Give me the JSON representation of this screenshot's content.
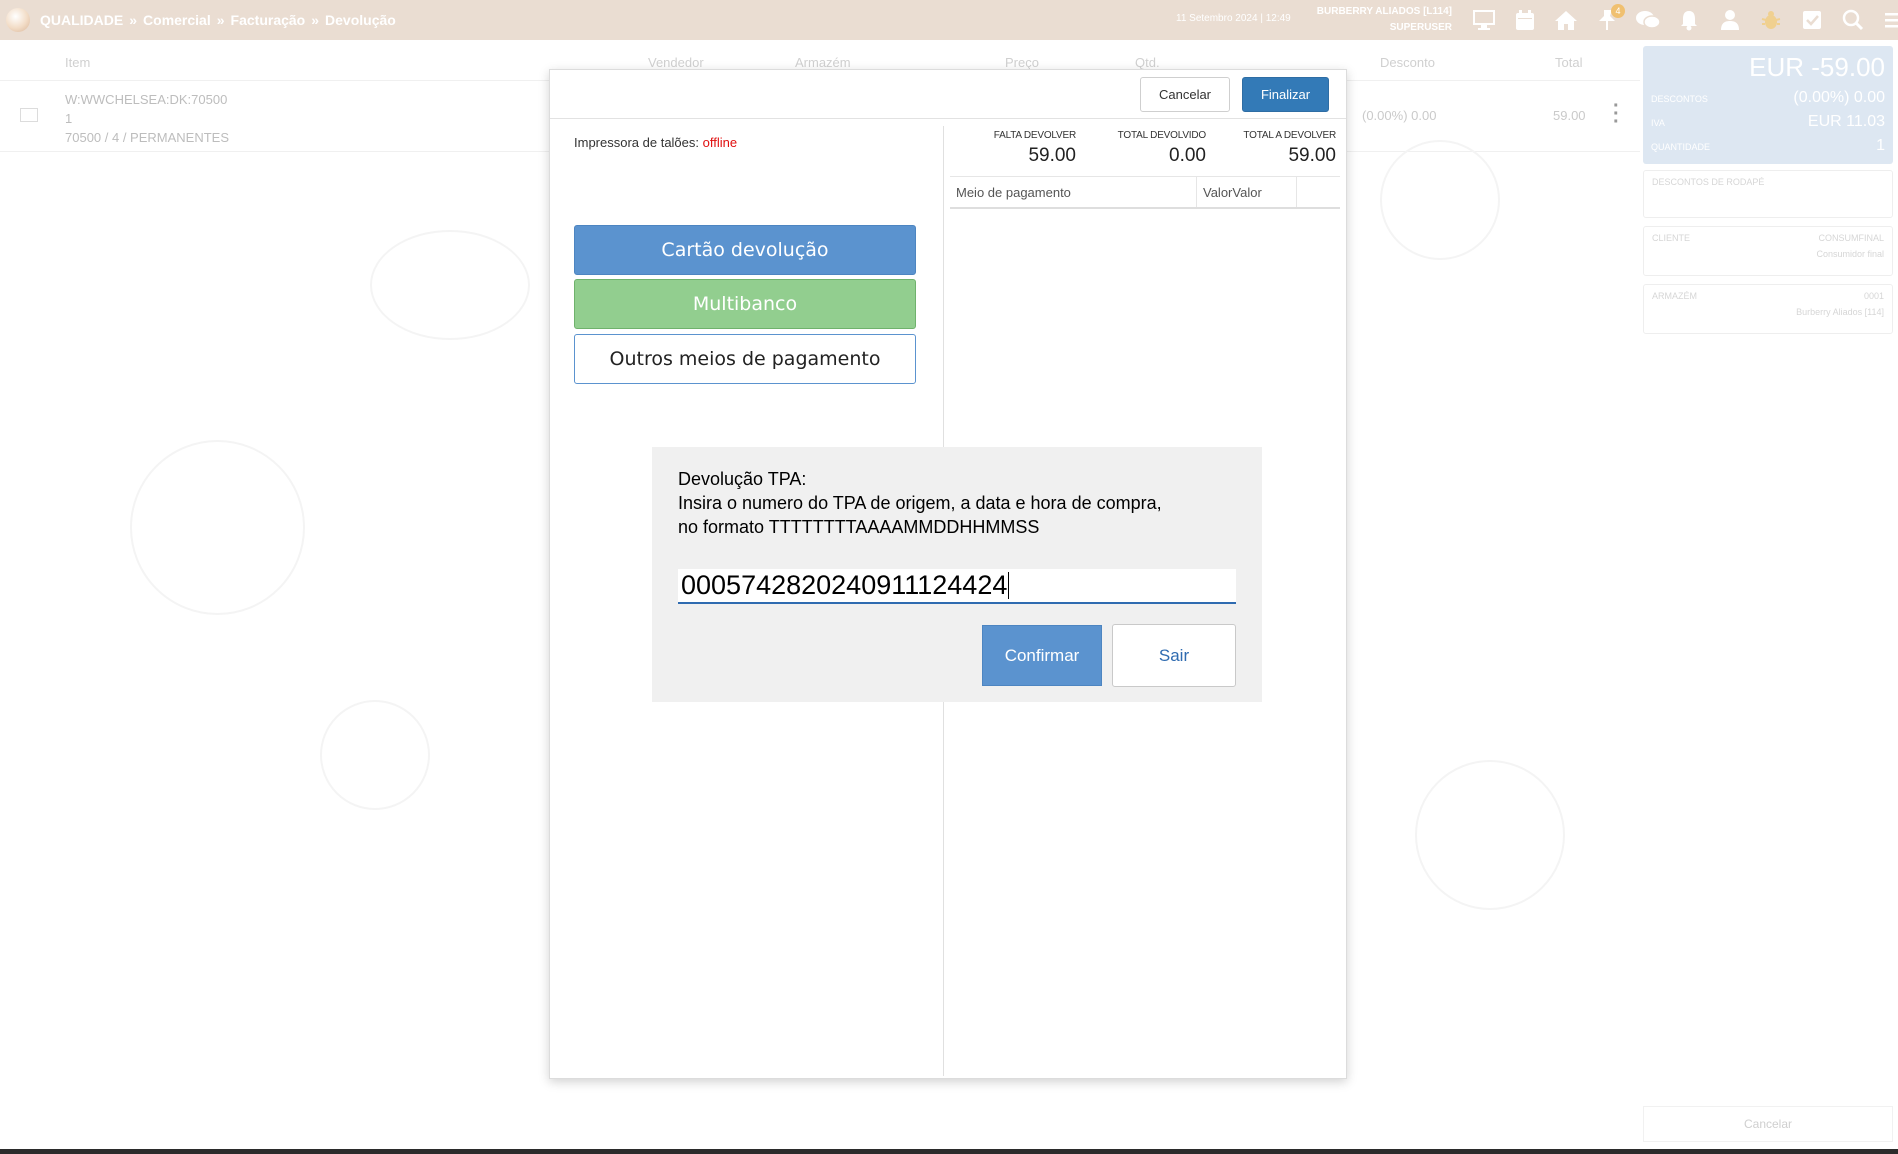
{
  "topbar": {
    "crumbs": [
      "QUALIDADE",
      "Comercial",
      "Facturação",
      "Devolução"
    ],
    "separator": "»",
    "datetime": "11 Setembro 2024 | 12:49",
    "company": "BURBERRY ALIADOS [L114]",
    "user": "SUPERUSER",
    "icons": [
      "monitor-icon",
      "calendar-icon",
      "home-icon",
      "pin-icon",
      "chat-icon",
      "bell-icon",
      "user-icon",
      "bug-icon",
      "checkbox-icon",
      "search-icon",
      "menu-icon"
    ],
    "pin_badge": "4"
  },
  "background_table": {
    "headers": {
      "item": "Item",
      "vendedor": "Vendedor",
      "armazem": "Armazém",
      "preco": "Preço",
      "qtd": "Qtd.",
      "desconto": "Desconto",
      "total": "Total"
    },
    "row": {
      "item_code": "W:WWCHELSEA:DK:70500",
      "item_qty": "1",
      "item_desc": "70500 / 4 / PERMANENTES",
      "discount": "(0.00%) 0.00",
      "total": "59.00"
    }
  },
  "right_panel": {
    "amount": "EUR -59.00",
    "descontos_label": "DESCONTOS",
    "descontos_value": "(0.00%) 0.00",
    "iva_label": "IVA",
    "iva_value": "EUR 11.03",
    "quantidade_label": "QUANTIDADE",
    "quantidade_value": "1",
    "descontos_rodape_label": "DESCONTOS DE RODAPÉ",
    "cliente_label": "CLIENTE",
    "cliente_code": "CONSUMFINAL",
    "cliente_name": "Consumidor final",
    "armazem_label": "ARMAZÉM",
    "armazem_code": "0001",
    "armazem_name": "Burberry Aliados [114]",
    "cancel_label": "Cancelar"
  },
  "modal": {
    "cancel_label": "Cancelar",
    "finalize_label": "Finalizar",
    "printer_label": "Impressora de talões:",
    "printer_status": "offline",
    "payment_buttons": [
      "Cartão devolução",
      "Multibanco",
      "Outros meios de pagamento"
    ],
    "summary": [
      {
        "label": "FALTA DEVOLVER",
        "value": "59.00"
      },
      {
        "label": "TOTAL DEVOLVIDO",
        "value": "0.00"
      },
      {
        "label": "TOTAL A DEVOLVER",
        "value": "59.00"
      }
    ],
    "table_headers": {
      "method": "Meio de pagamento",
      "value": "ValorValor"
    }
  },
  "tpa_dialog": {
    "line1": "Devolução TPA:",
    "line2": "Insira o numero do TPA de origem, a data e hora de compra,",
    "line3": "no formato TTTTTTTTAAAAMMDDHHMMSS",
    "input_value": "000574282024091112442",
    "input_value_end": "4",
    "confirm_label": "Confirmar",
    "exit_label": "Sair"
  },
  "colors": {
    "topbar": "#eaddd2",
    "primary": "#337ab7",
    "blue_btn": "#5b93cf",
    "green_btn": "#92ce8f",
    "offline": "#e01010"
  }
}
